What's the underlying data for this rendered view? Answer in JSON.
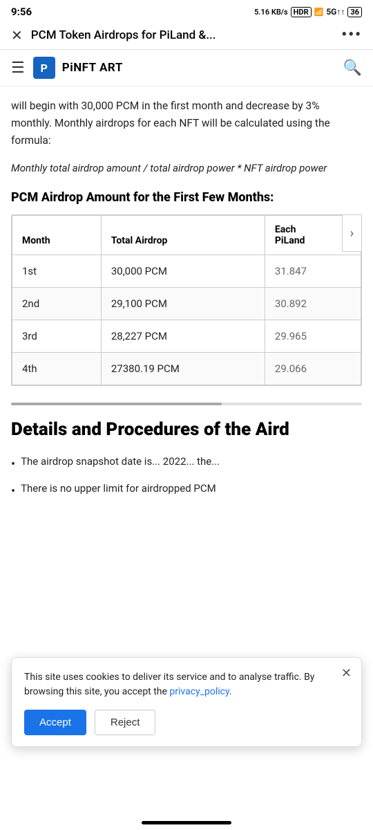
{
  "statusBar": {
    "time": "9:56",
    "speed": "5.16 KB/s",
    "hdr": "HDR",
    "battery": "36"
  },
  "topNav": {
    "closeIcon": "✕",
    "title": "PCM Token Airdrops for PiLand &...",
    "moreIcon": "•••"
  },
  "subHeader": {
    "menuIcon": "☰",
    "logoLetter": "P",
    "siteTitle": "PiNFT ART",
    "searchIcon": "🔍"
  },
  "introText": "will begin with 30,000 PCM in the first month and decrease by 3% monthly. Monthly airdrops for each NFT will be calculated using the formula:",
  "formulaText": "Monthly total airdrop amount / total airdrop power * NFT airdrop power",
  "sectionTitle": "PCM Airdrop Amount for the First Few Months:",
  "table": {
    "headers": [
      "Month",
      "Total Airdrop",
      "Each PiLand"
    ],
    "rows": [
      {
        "month": "1st",
        "totalAirdrop": "30,000 PCM",
        "eachPiland": "31.847"
      },
      {
        "month": "2nd",
        "totalAirdrop": "29,100 PCM",
        "eachPiland": "30.892"
      },
      {
        "month": "3rd",
        "totalAirdrop": "28,227 PCM",
        "eachPiland": "29.965"
      },
      {
        "month": "4th",
        "totalAirdrop": "27380.19 PCM",
        "eachPiland": "29.066"
      }
    ]
  },
  "section2Title": "Details and Procedures of the Aird",
  "bullets": [
    {
      "text": "The airdrop snapshot date is... 2022... the..."
    },
    {
      "text": "There is no upper limit for airdropped PCM"
    }
  ],
  "cookieBanner": {
    "text": "This site uses cookies to deliver its service and to analyse traffic. By browsing this site, you accept the ",
    "linkText": "privacy_policy",
    "textAfter": ".",
    "acceptLabel": "Accept",
    "rejectLabel": "Reject"
  }
}
